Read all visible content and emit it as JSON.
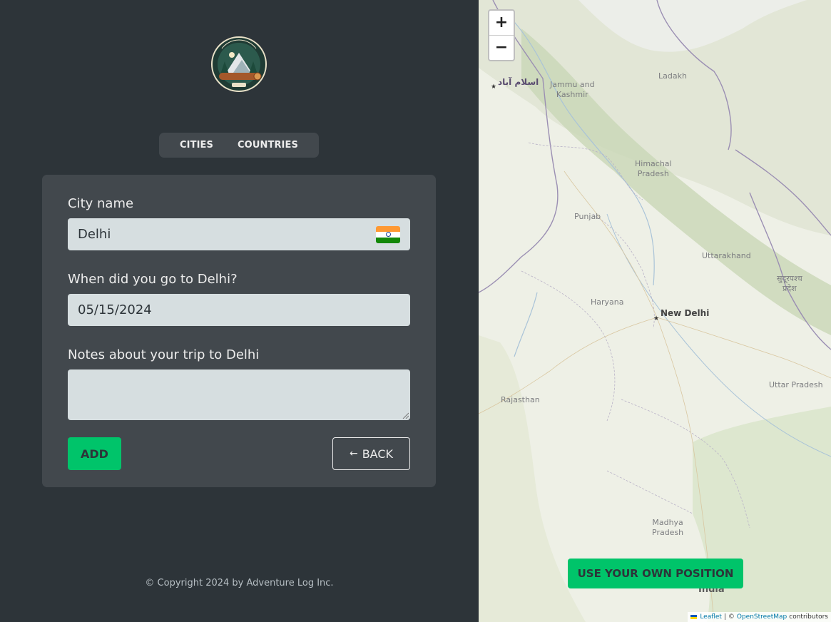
{
  "tabs": {
    "cities": "CITIES",
    "countries": "COUNTRIES"
  },
  "form": {
    "city_label": "City name",
    "city_value": "Delhi",
    "date_label": "When did you go to Delhi?",
    "date_value": "05/15/2024",
    "notes_label": "Notes about your trip to Delhi",
    "notes_value": "",
    "add_button": "ADD",
    "back_arrow": "←",
    "back_button": "BACK"
  },
  "footer": {
    "copyright": "© Copyright 2024 by Adventure Log Inc."
  },
  "map": {
    "zoom_in": "+",
    "zoom_out": "−",
    "use_position_button": "USE YOUR OWN POSITION",
    "labels": {
      "islamabad": "اسلام آباد",
      "jammu_kashmir_1": "Jammu and",
      "jammu_kashmir_2": "Kashmir",
      "ladakh": "Ladakh",
      "himachal_1": "Himachal",
      "himachal_2": "Pradesh",
      "punjab": "Punjab",
      "uttarakhand": "Uttarakhand",
      "nepal_1": "सुदूरपश्च",
      "nepal_2": "प्रदेश",
      "haryana": "Haryana",
      "new_delhi": "New Delhi",
      "rajasthan": "Rajasthan",
      "uttar_pradesh": "Uttar Pradesh",
      "madhya_1": "Madhya",
      "madhya_2": "Pradesh",
      "india": "India"
    },
    "attribution": {
      "leaflet": "Leaflet",
      "separator": "| ©",
      "osm": "OpenStreetMap",
      "contributors": "contributors"
    }
  },
  "colors": {
    "background": "#2d3439",
    "card": "#42484d",
    "input": "#d6dee0",
    "accent": "#00c46a",
    "text": "#ececec"
  }
}
